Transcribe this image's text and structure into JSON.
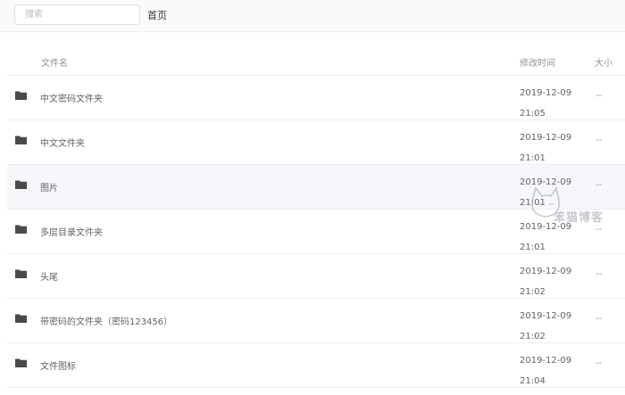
{
  "search": {
    "placeholder": "搜索"
  },
  "breadcrumb": {
    "home": "首页"
  },
  "table": {
    "headers": {
      "name": "文件名",
      "modified": "修改时间",
      "size": "大小"
    },
    "rows": [
      {
        "name": "中文密码文件夹",
        "modified": "2019-12-09 21:05",
        "size": "--"
      },
      {
        "name": "中文文件夹",
        "modified": "2019-12-09 21:01",
        "size": "--"
      },
      {
        "name": "图片",
        "modified": "2019-12-09 21:01",
        "size": "--"
      },
      {
        "name": "多层目录文件夹",
        "modified": "2019-12-09 21:01",
        "size": "--"
      },
      {
        "name": "头尾",
        "modified": "2019-12-09 21:02",
        "size": "--"
      },
      {
        "name": "带密码的文件夹（密码123456）",
        "modified": "2019-12-09 21:02",
        "size": "--"
      },
      {
        "name": "文件图标",
        "modified": "2019-12-09 21:04",
        "size": "--"
      }
    ]
  },
  "watermark": {
    "text": "笨猫博客"
  },
  "colors": {
    "folder_icon": "#4a4a4a",
    "row_highlight": "#f5f7fa",
    "border": "#ebeef5"
  }
}
